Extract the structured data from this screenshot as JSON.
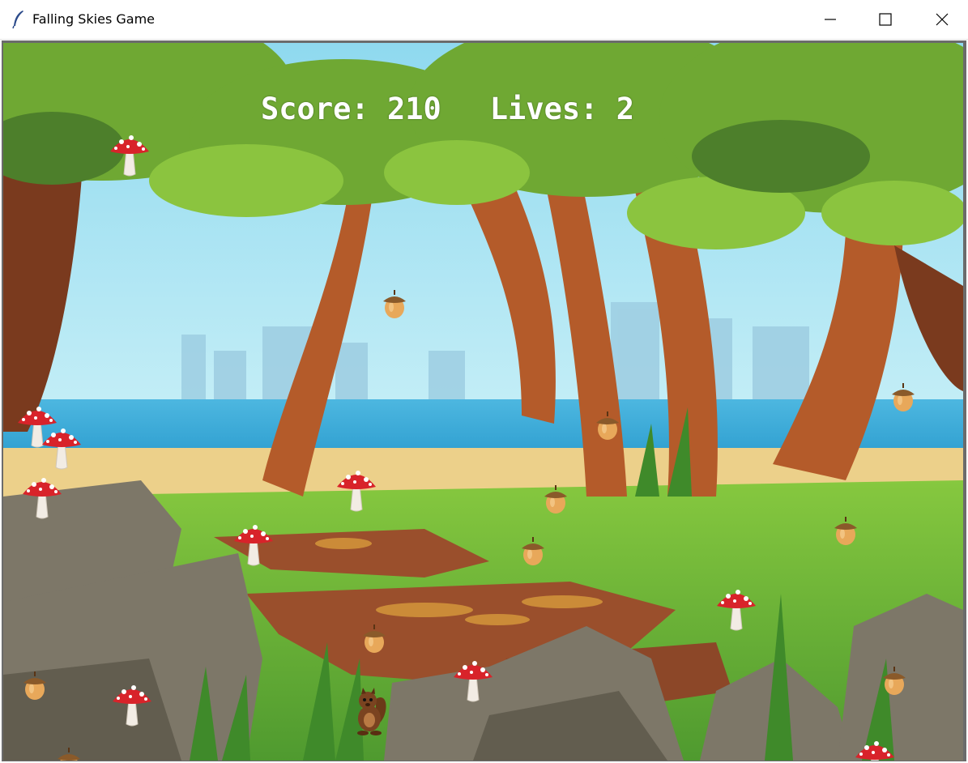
{
  "window": {
    "title": "Falling Skies Game",
    "icon": "feather-icon",
    "controls": [
      "minimize-icon",
      "maximize-icon",
      "close-icon"
    ]
  },
  "hud": {
    "score_label": "Score:",
    "score_value": "210",
    "lives_label": "Lives:",
    "lives_value": "2"
  },
  "scene": {
    "background": "forest-clearing",
    "falling_items": [
      "acorn",
      "mushroom"
    ],
    "player": "squirrel",
    "colors": {
      "sky": "#a9e6f5",
      "grass": "#6fb83a",
      "hud_text": "#ffffff",
      "mushroom_cap": "#d8232a",
      "acorn": "#e8a85a"
    }
  }
}
